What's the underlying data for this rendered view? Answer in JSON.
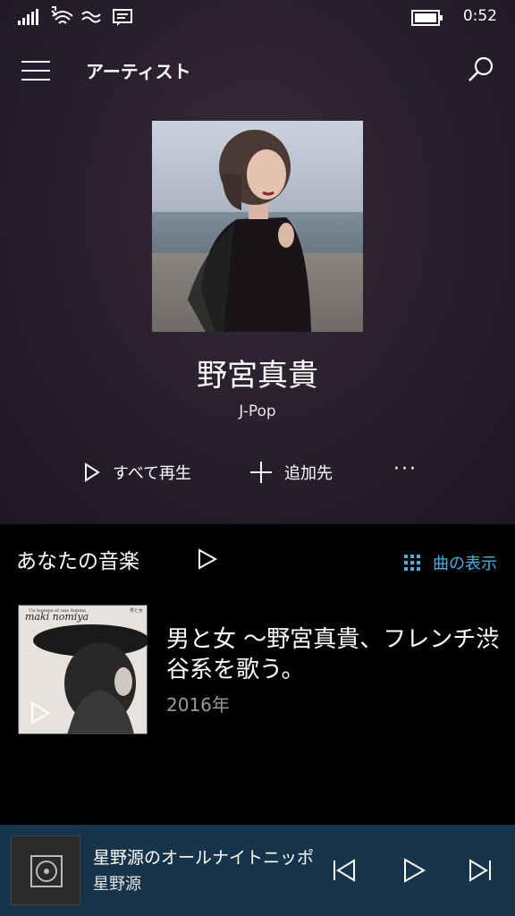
{
  "status_bar": {
    "time": "0:52"
  },
  "header": {
    "title": "アーティスト"
  },
  "artist": {
    "name": "野宮真貴",
    "genre": "J-Pop"
  },
  "actions": {
    "play_all": "すべて再生",
    "add_to": "追加先",
    "more": "···"
  },
  "your_music": {
    "title": "あなたの音楽",
    "show_songs": "曲の表示",
    "albums": [
      {
        "title": "男と女 ～野宮真貴、フレンチ渋谷系を歌う。",
        "year": "2016年",
        "cover_text": "maki nomiya",
        "cover_small_text": "Un homme et une femme",
        "cover_jp_text": "男と女"
      }
    ]
  },
  "now_playing": {
    "title": "星野源のオールナイトニッポン",
    "artist": "星野源"
  },
  "colors": {
    "accent": "#3bb3e6",
    "now_playing_bg": "#16354a"
  }
}
